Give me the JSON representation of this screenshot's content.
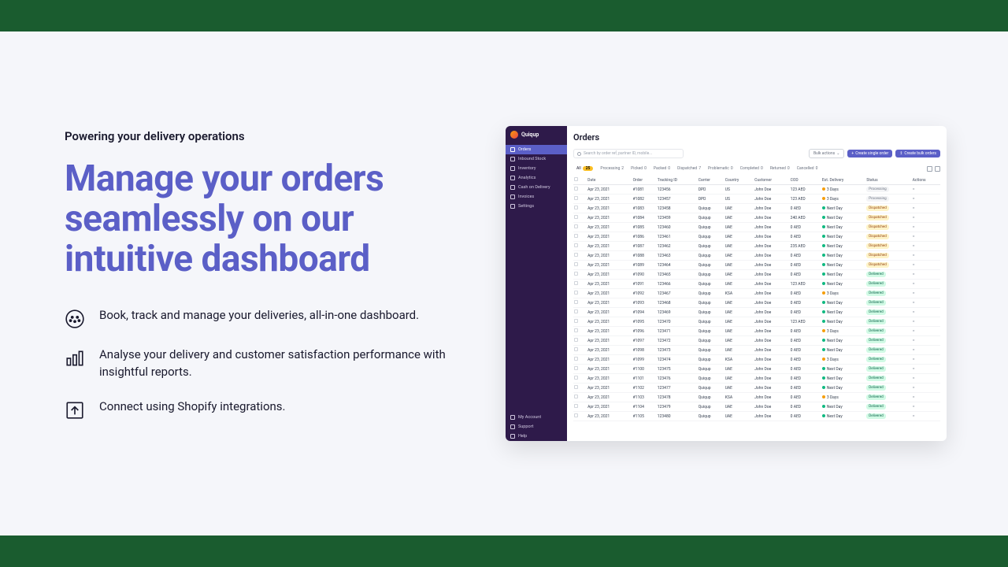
{
  "marketing": {
    "eyebrow": "Powering your delivery operations",
    "headline": "Manage your orders seamlessly on our intuitive dashboard",
    "features": [
      "Book, track and manage your deliveries, all-in-one dashboard.",
      "Analyse your delivery and customer satisfaction performance with insightful reports.",
      "Connect using Shopify integrations."
    ]
  },
  "dashboard": {
    "brand": "Quiqup",
    "nav": [
      {
        "label": "Orders",
        "active": true
      },
      {
        "label": "Inbound Stock"
      },
      {
        "label": "Inventory"
      },
      {
        "label": "Analytics"
      },
      {
        "label": "Cash on Delivery"
      },
      {
        "label": "Invoices"
      },
      {
        "label": "Settings"
      }
    ],
    "nav_bottom": [
      {
        "label": "My Account"
      },
      {
        "label": "Support"
      },
      {
        "label": "Help"
      }
    ],
    "title": "Orders",
    "search_placeholder": "Search by order ref, partner ID, mobile...",
    "bulk_label": "Bulk actions",
    "create_single": "Create single order",
    "create_bulk": "Create bulk orders",
    "tabs": [
      {
        "name": "All",
        "count": "25",
        "active": true
      },
      {
        "name": "Processing",
        "count": "2"
      },
      {
        "name": "Picked",
        "count": "0"
      },
      {
        "name": "Packed",
        "count": "0"
      },
      {
        "name": "Dispatched",
        "count": "7"
      },
      {
        "name": "Problematic",
        "count": "0"
      },
      {
        "name": "Completed",
        "count": "0"
      },
      {
        "name": "Returned",
        "count": "0"
      },
      {
        "name": "Cancelled",
        "count": "0"
      }
    ],
    "columns": [
      "",
      "Date",
      "Order",
      "Tracking ID",
      "Carrier",
      "Country",
      "Customer",
      "COD",
      "Est. Delivery",
      "Status",
      "Actions"
    ],
    "rows": [
      {
        "date": "Apr 23, 2021",
        "order": "#1081",
        "track": "123456",
        "carrier": "DPD",
        "country": "US",
        "cust": "John Doe",
        "cod": "123 AED",
        "eta": "3 Days",
        "eta_dot": "yellow",
        "status": "Processing",
        "status_c": "gray"
      },
      {
        "date": "Apr 23, 2021",
        "order": "#1082",
        "track": "123457",
        "carrier": "DPD",
        "country": "US",
        "cust": "John Doe",
        "cod": "123 AED",
        "eta": "3 Days",
        "eta_dot": "yellow",
        "status": "Processing",
        "status_c": "gray"
      },
      {
        "date": "Apr 23, 2021",
        "order": "#1083",
        "track": "123458",
        "carrier": "Quiqup",
        "country": "UAE",
        "cust": "John Doe",
        "cod": "0 AED",
        "eta": "Next Day",
        "eta_dot": "green",
        "status": "Dispatched",
        "status_c": "yellow"
      },
      {
        "date": "Apr 23, 2021",
        "order": "#1084",
        "track": "123459",
        "carrier": "Quiqup",
        "country": "UAE",
        "cust": "John Doe",
        "cod": "240 AED",
        "eta": "Next Day",
        "eta_dot": "green",
        "status": "Dispatched",
        "status_c": "yellow"
      },
      {
        "date": "Apr 23, 2021",
        "order": "#1085",
        "track": "123460",
        "carrier": "Quiqup",
        "country": "UAE",
        "cust": "John Doe",
        "cod": "0 AED",
        "eta": "Next Day",
        "eta_dot": "green",
        "status": "Dispatched",
        "status_c": "yellow"
      },
      {
        "date": "Apr 23, 2021",
        "order": "#1086",
        "track": "123461",
        "carrier": "Quiqup",
        "country": "UAE",
        "cust": "John Doe",
        "cod": "0 AED",
        "eta": "Next Day",
        "eta_dot": "green",
        "status": "Dispatched",
        "status_c": "yellow"
      },
      {
        "date": "Apr 23, 2021",
        "order": "#1087",
        "track": "123462",
        "carrier": "Quiqup",
        "country": "UAE",
        "cust": "John Doe",
        "cod": "235 AED",
        "eta": "Next Day",
        "eta_dot": "green",
        "status": "Dispatched",
        "status_c": "yellow"
      },
      {
        "date": "Apr 23, 2021",
        "order": "#1088",
        "track": "123463",
        "carrier": "Quiqup",
        "country": "UAE",
        "cust": "John Doe",
        "cod": "0 AED",
        "eta": "Next Day",
        "eta_dot": "green",
        "status": "Dispatched",
        "status_c": "yellow"
      },
      {
        "date": "Apr 23, 2021",
        "order": "#1089",
        "track": "123464",
        "carrier": "Quiqup",
        "country": "UAE",
        "cust": "John Doe",
        "cod": "0 AED",
        "eta": "Next Day",
        "eta_dot": "green",
        "status": "Dispatched",
        "status_c": "yellow"
      },
      {
        "date": "Apr 23, 2021",
        "order": "#1090",
        "track": "123465",
        "carrier": "Quiqup",
        "country": "UAE",
        "cust": "John Doe",
        "cod": "0 AED",
        "eta": "Next Day",
        "eta_dot": "green",
        "status": "Delivered",
        "status_c": "green"
      },
      {
        "date": "Apr 23, 2021",
        "order": "#1091",
        "track": "123466",
        "carrier": "Quiqup",
        "country": "UAE",
        "cust": "John Doe",
        "cod": "123 AED",
        "eta": "Next Day",
        "eta_dot": "green",
        "status": "Delivered",
        "status_c": "green"
      },
      {
        "date": "Apr 23, 2021",
        "order": "#1092",
        "track": "123467",
        "carrier": "Quiqup",
        "country": "KSA",
        "cust": "John Doe",
        "cod": "0 AED",
        "eta": "3 Days",
        "eta_dot": "yellow",
        "status": "Delivered",
        "status_c": "green"
      },
      {
        "date": "Apr 23, 2021",
        "order": "#1093",
        "track": "123468",
        "carrier": "Quiqup",
        "country": "UAE",
        "cust": "John Doe",
        "cod": "0 AED",
        "eta": "Next Day",
        "eta_dot": "green",
        "status": "Delivered",
        "status_c": "green"
      },
      {
        "date": "Apr 23, 2021",
        "order": "#1094",
        "track": "123469",
        "carrier": "Quiqup",
        "country": "UAE",
        "cust": "John Doe",
        "cod": "0 AED",
        "eta": "Next Day",
        "eta_dot": "green",
        "status": "Delivered",
        "status_c": "green"
      },
      {
        "date": "Apr 23, 2021",
        "order": "#1095",
        "track": "123470",
        "carrier": "Quiqup",
        "country": "UAE",
        "cust": "John Doe",
        "cod": "123 AED",
        "eta": "Next Day",
        "eta_dot": "green",
        "status": "Delivered",
        "status_c": "green"
      },
      {
        "date": "Apr 23, 2021",
        "order": "#1096",
        "track": "123471",
        "carrier": "Quiqup",
        "country": "UAE",
        "cust": "John Doe",
        "cod": "0 AED",
        "eta": "3 Days",
        "eta_dot": "yellow",
        "status": "Delivered",
        "status_c": "green"
      },
      {
        "date": "Apr 23, 2021",
        "order": "#1097",
        "track": "123472",
        "carrier": "Quiqup",
        "country": "UAE",
        "cust": "John Doe",
        "cod": "0 AED",
        "eta": "Next Day",
        "eta_dot": "green",
        "status": "Delivered",
        "status_c": "green"
      },
      {
        "date": "Apr 23, 2021",
        "order": "#1098",
        "track": "123473",
        "carrier": "Quiqup",
        "country": "UAE",
        "cust": "John Doe",
        "cod": "0 AED",
        "eta": "Next Day",
        "eta_dot": "green",
        "status": "Delivered",
        "status_c": "green"
      },
      {
        "date": "Apr 23, 2021",
        "order": "#1099",
        "track": "123474",
        "carrier": "Quiqup",
        "country": "KSA",
        "cust": "John Doe",
        "cod": "0 AED",
        "eta": "3 Days",
        "eta_dot": "yellow",
        "status": "Delivered",
        "status_c": "green"
      },
      {
        "date": "Apr 23, 2021",
        "order": "#1100",
        "track": "123475",
        "carrier": "Quiqup",
        "country": "UAE",
        "cust": "John Doe",
        "cod": "0 AED",
        "eta": "Next Day",
        "eta_dot": "green",
        "status": "Delivered",
        "status_c": "green"
      },
      {
        "date": "Apr 23, 2021",
        "order": "#1101",
        "track": "123476",
        "carrier": "Quiqup",
        "country": "UAE",
        "cust": "John Doe",
        "cod": "0 AED",
        "eta": "Next Day",
        "eta_dot": "green",
        "status": "Delivered",
        "status_c": "green"
      },
      {
        "date": "Apr 23, 2021",
        "order": "#1102",
        "track": "123477",
        "carrier": "Quiqup",
        "country": "UAE",
        "cust": "John Doe",
        "cod": "0 AED",
        "eta": "Next Day",
        "eta_dot": "green",
        "status": "Delivered",
        "status_c": "green"
      },
      {
        "date": "Apr 23, 2021",
        "order": "#1103",
        "track": "123478",
        "carrier": "Quiqup",
        "country": "KSA",
        "cust": "John Doe",
        "cod": "0 AED",
        "eta": "3 Days",
        "eta_dot": "yellow",
        "status": "Delivered",
        "status_c": "green"
      },
      {
        "date": "Apr 23, 2021",
        "order": "#1104",
        "track": "123479",
        "carrier": "Quiqup",
        "country": "UAE",
        "cust": "John Doe",
        "cod": "0 AED",
        "eta": "Next Day",
        "eta_dot": "green",
        "status": "Delivered",
        "status_c": "green"
      },
      {
        "date": "Apr 23, 2021",
        "order": "#1105",
        "track": "123480",
        "carrier": "Quiqup",
        "country": "UAE",
        "cust": "John Doe",
        "cod": "0 AED",
        "eta": "Next Day",
        "eta_dot": "green",
        "status": "Delivered",
        "status_c": "green"
      }
    ]
  }
}
